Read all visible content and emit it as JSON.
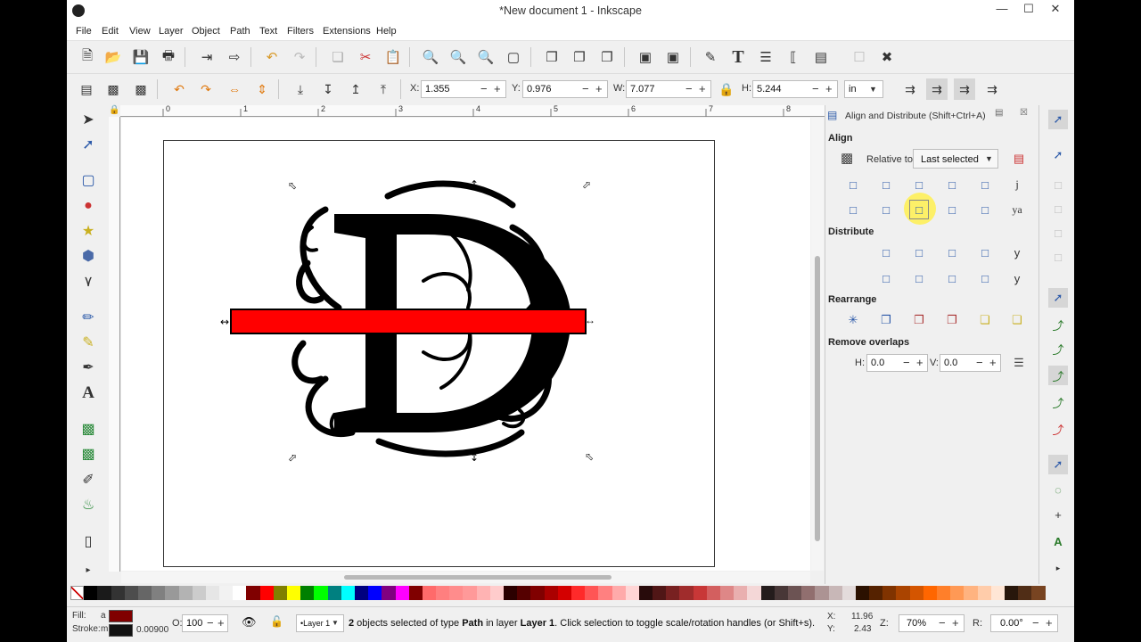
{
  "window": {
    "title": "*New document 1 - Inkscape"
  },
  "menu": [
    "File",
    "Edit",
    "View",
    "Layer",
    "Object",
    "Path",
    "Text",
    "Filters",
    "Extensions",
    "Help"
  ],
  "toolbar": {
    "x_label": "X:",
    "x_value": "1.355",
    "y_label": "Y:",
    "y_value": "0.976",
    "w_label": "W:",
    "w_value": "7.077",
    "h_label": "H:",
    "h_value": "5.244",
    "unit": "in"
  },
  "ruler_marks": [
    "0",
    "1",
    "2",
    "3",
    "4",
    "5",
    "6",
    "7",
    "8"
  ],
  "dock": {
    "title": "Align and Distribute (Shift+Ctrl+A)",
    "align_header": "Align",
    "relative_to_label": "Relative to:",
    "relative_to_value": "Last selected",
    "distribute_header": "Distribute",
    "rearrange_header": "Rearrange",
    "remove_overlaps_header": "Remove overlaps",
    "h_label": "H:",
    "h_value": "0.0",
    "v_label": "V:",
    "v_value": "0.0"
  },
  "status": {
    "fill_label": "Fill:",
    "fill_value": "a",
    "stroke_label": "Stroke:",
    "stroke_value": "m",
    "stroke_width": "0.00900",
    "opacity_label": "O:",
    "opacity_value": "100",
    "layer": "•Layer 1",
    "message_bold1": "2",
    "message_part1": " objects selected of type ",
    "message_bold2": "Path",
    "message_part2": " in layer ",
    "message_bold3": "Layer 1",
    "message_part3": ". Click selection to toggle scale/rotation handles (or Shift+s).",
    "cursor_x_label": "X:",
    "cursor_x": "11.96",
    "cursor_y_label": "Y:",
    "cursor_y": "2.43",
    "zoom_label": "Z:",
    "zoom": "70%",
    "rotation_label": "R:",
    "rotation": "0.00°"
  },
  "colors": {
    "fill": "#800000",
    "stroke": "#111111",
    "red_bar": "#ff0000",
    "accent_blue": "#2a58a8"
  },
  "palette": [
    "#000000",
    "#1a1a1a",
    "#333333",
    "#4d4d4d",
    "#666666",
    "#808080",
    "#999999",
    "#b3b3b3",
    "#cccccc",
    "#e6e6e6",
    "#f2f2f2",
    "#ffffff",
    "#800000",
    "#ff0000",
    "#808000",
    "#ffff00",
    "#008000",
    "#00ff00",
    "#008080",
    "#00ffff",
    "#000080",
    "#0000ff",
    "#800080",
    "#ff00ff",
    "#800000",
    "#ff6a6a",
    "#ff7f7f",
    "#ff8c8c",
    "#ff9999",
    "#ffb3b3",
    "#ffcccc",
    "#2b0000",
    "#550000",
    "#800000",
    "#aa0000",
    "#d40000",
    "#ff2a2a",
    "#ff5555",
    "#ff8080",
    "#ffaaaa",
    "#ffd5d5",
    "#280b0b",
    "#501616",
    "#782121",
    "#a02c2c",
    "#c83737",
    "#d35f5f",
    "#de8787",
    "#e9afaf",
    "#f4d7d7",
    "#241c1c",
    "#483737",
    "#6c5353",
    "#916f6f",
    "#ac9393",
    "#c8b7b7",
    "#e3dbdb",
    "#2b1100",
    "#552200",
    "#803300",
    "#aa4400",
    "#d45500",
    "#ff6600",
    "#ff7f2a",
    "#ff9955",
    "#ffb380",
    "#ffccaa",
    "#ffe6d5",
    "#28170b",
    "#502d16",
    "#784421"
  ]
}
